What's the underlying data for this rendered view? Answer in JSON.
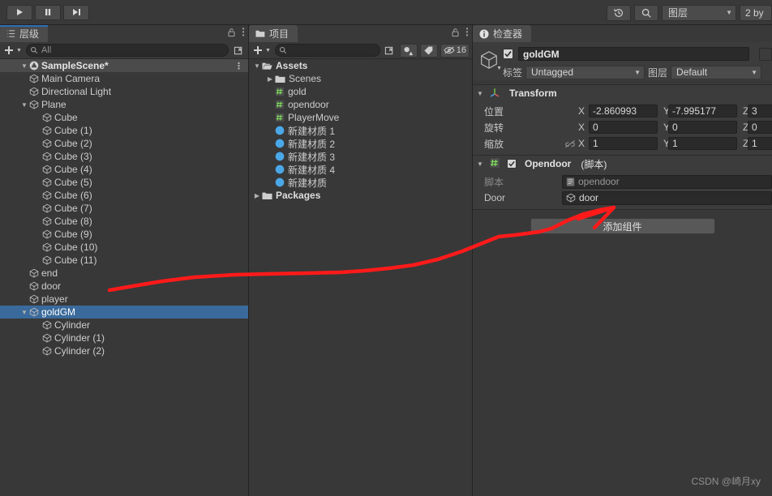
{
  "toolbar": {
    "play_label": "play-icon",
    "pause_label": "pause-icon",
    "step_label": "step-icon",
    "history_icon": "history-icon",
    "search_icon": "search-icon",
    "layers_label": "图层",
    "layout_label": "2 by"
  },
  "hierarchy": {
    "tab_label": "层级",
    "add_label": "+",
    "search_value": "All",
    "scene_name": "SampleScene*",
    "items": [
      {
        "label": "Main Camera",
        "depth": 2,
        "expandable": false,
        "selected": false
      },
      {
        "label": "Directional Light",
        "depth": 2,
        "expandable": false,
        "selected": false
      },
      {
        "label": "Plane",
        "depth": 2,
        "expandable": true,
        "selected": false
      },
      {
        "label": "Cube",
        "depth": 3,
        "expandable": false,
        "selected": false
      },
      {
        "label": "Cube (1)",
        "depth": 3,
        "expandable": false,
        "selected": false
      },
      {
        "label": "Cube (2)",
        "depth": 3,
        "expandable": false,
        "selected": false
      },
      {
        "label": "Cube (3)",
        "depth": 3,
        "expandable": false,
        "selected": false
      },
      {
        "label": "Cube (4)",
        "depth": 3,
        "expandable": false,
        "selected": false
      },
      {
        "label": "Cube (5)",
        "depth": 3,
        "expandable": false,
        "selected": false
      },
      {
        "label": "Cube (6)",
        "depth": 3,
        "expandable": false,
        "selected": false
      },
      {
        "label": "Cube (7)",
        "depth": 3,
        "expandable": false,
        "selected": false
      },
      {
        "label": "Cube (8)",
        "depth": 3,
        "expandable": false,
        "selected": false
      },
      {
        "label": "Cube (9)",
        "depth": 3,
        "expandable": false,
        "selected": false
      },
      {
        "label": "Cube (10)",
        "depth": 3,
        "expandable": false,
        "selected": false
      },
      {
        "label": "Cube (11)",
        "depth": 3,
        "expandable": false,
        "selected": false
      },
      {
        "label": "end",
        "depth": 2,
        "expandable": false,
        "selected": false
      },
      {
        "label": "door",
        "depth": 2,
        "expandable": false,
        "selected": false
      },
      {
        "label": "player",
        "depth": 2,
        "expandable": false,
        "selected": false
      },
      {
        "label": "goldGM",
        "depth": 2,
        "expandable": true,
        "selected": true
      },
      {
        "label": "Cylinder",
        "depth": 3,
        "expandable": false,
        "selected": false
      },
      {
        "label": "Cylinder (1)",
        "depth": 3,
        "expandable": false,
        "selected": false
      },
      {
        "label": "Cylinder (2)",
        "depth": 3,
        "expandable": false,
        "selected": false
      }
    ]
  },
  "project": {
    "tab_label": "项目",
    "add_label": "+",
    "search_value": "",
    "hidden_count": "16",
    "items": [
      {
        "label": "Assets",
        "depth": 0,
        "kind": "folder",
        "expanded": true,
        "bold": true
      },
      {
        "label": "Scenes",
        "depth": 1,
        "kind": "folder",
        "expanded": false,
        "bold": false
      },
      {
        "label": "gold",
        "depth": 1,
        "kind": "script",
        "expanded": null,
        "bold": false
      },
      {
        "label": "opendoor",
        "depth": 1,
        "kind": "script",
        "expanded": null,
        "bold": false
      },
      {
        "label": "PlayerMove",
        "depth": 1,
        "kind": "script",
        "expanded": null,
        "bold": false
      },
      {
        "label": "新建材质 1",
        "depth": 1,
        "kind": "material",
        "expanded": null,
        "bold": false
      },
      {
        "label": "新建材质 2",
        "depth": 1,
        "kind": "material",
        "expanded": null,
        "bold": false
      },
      {
        "label": "新建材质 3",
        "depth": 1,
        "kind": "material",
        "expanded": null,
        "bold": false
      },
      {
        "label": "新建材质 4",
        "depth": 1,
        "kind": "material",
        "expanded": null,
        "bold": false
      },
      {
        "label": "新建材质",
        "depth": 1,
        "kind": "material",
        "expanded": null,
        "bold": false
      },
      {
        "label": "Packages",
        "depth": 0,
        "kind": "folder",
        "expanded": false,
        "bold": true
      }
    ]
  },
  "inspector": {
    "tab_label": "检查器",
    "object_name": "goldGM",
    "enabled": true,
    "tag_label": "标签",
    "tag_value": "Untagged",
    "layer_label": "图层",
    "layer_value": "Default",
    "transform": {
      "title": "Transform",
      "rows": [
        {
          "label": "位置",
          "x": "-2.860993",
          "y": "-7.995177",
          "z": "3"
        },
        {
          "label": "旋转",
          "x": "0",
          "y": "0",
          "z": "0"
        },
        {
          "label": "缩放",
          "x": "1",
          "y": "1",
          "z": "1"
        }
      ],
      "axis_x": "X",
      "axis_y": "Y",
      "axis_z": "Z"
    },
    "script_component": {
      "title": "Opendoor",
      "title_suffix": "(脚本)",
      "enabled": true,
      "fields": [
        {
          "label": "脚本",
          "value": "opendoor",
          "dim": true,
          "icon": "script-icon"
        },
        {
          "label": "Door",
          "value": "door",
          "dim": false,
          "icon": "cube-icon"
        }
      ]
    },
    "add_component_label": "添加组件"
  },
  "watermark": "CSDN @崎月xy",
  "colors": {
    "selection_blue": "#3a6a9b",
    "tab_focus_blue": "#2c6fb5",
    "annotation_red": "#ff1a1a",
    "panel_bg": "#383838",
    "header_bg": "#393939"
  }
}
